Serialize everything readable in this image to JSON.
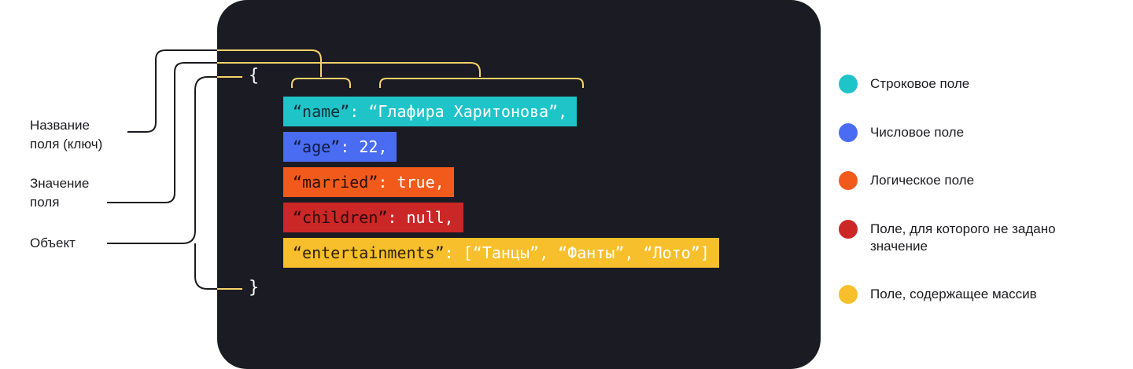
{
  "labels": {
    "key_name": "Название\nполя (ключ)",
    "field_value": "Значение\nполя",
    "object": "Объект"
  },
  "code": {
    "open_brace": "{",
    "close_brace": "}",
    "lines": [
      {
        "key": "“name”",
        "sep": ": ",
        "value": "“Глафира Харитонова”,"
      },
      {
        "key": "“age”",
        "sep": ": ",
        "value": "22,"
      },
      {
        "key": "“married”",
        "sep": ": ",
        "value": "true,"
      },
      {
        "key": "“children”",
        "sep": ": ",
        "value": "null,"
      },
      {
        "key": "“entertainments”",
        "sep": ": ",
        "value": "[“Танцы”, “Фанты”, “Лото”]"
      }
    ]
  },
  "legend": [
    {
      "label": "Строковое поле",
      "color": "#1fc4c9"
    },
    {
      "label": "Числовое поле",
      "color": "#4a6cf2"
    },
    {
      "label": "Логическое поле",
      "color": "#f25a1c"
    },
    {
      "label": "Поле, для которого не задано значение",
      "color": "#cc2727"
    },
    {
      "label": "Поле, содержащее массив",
      "color": "#f7bf2b"
    }
  ],
  "colors": {
    "panel": "#1b1b23",
    "connector_dark": "#1b1b1f",
    "connector_light": "#f7d36a"
  }
}
